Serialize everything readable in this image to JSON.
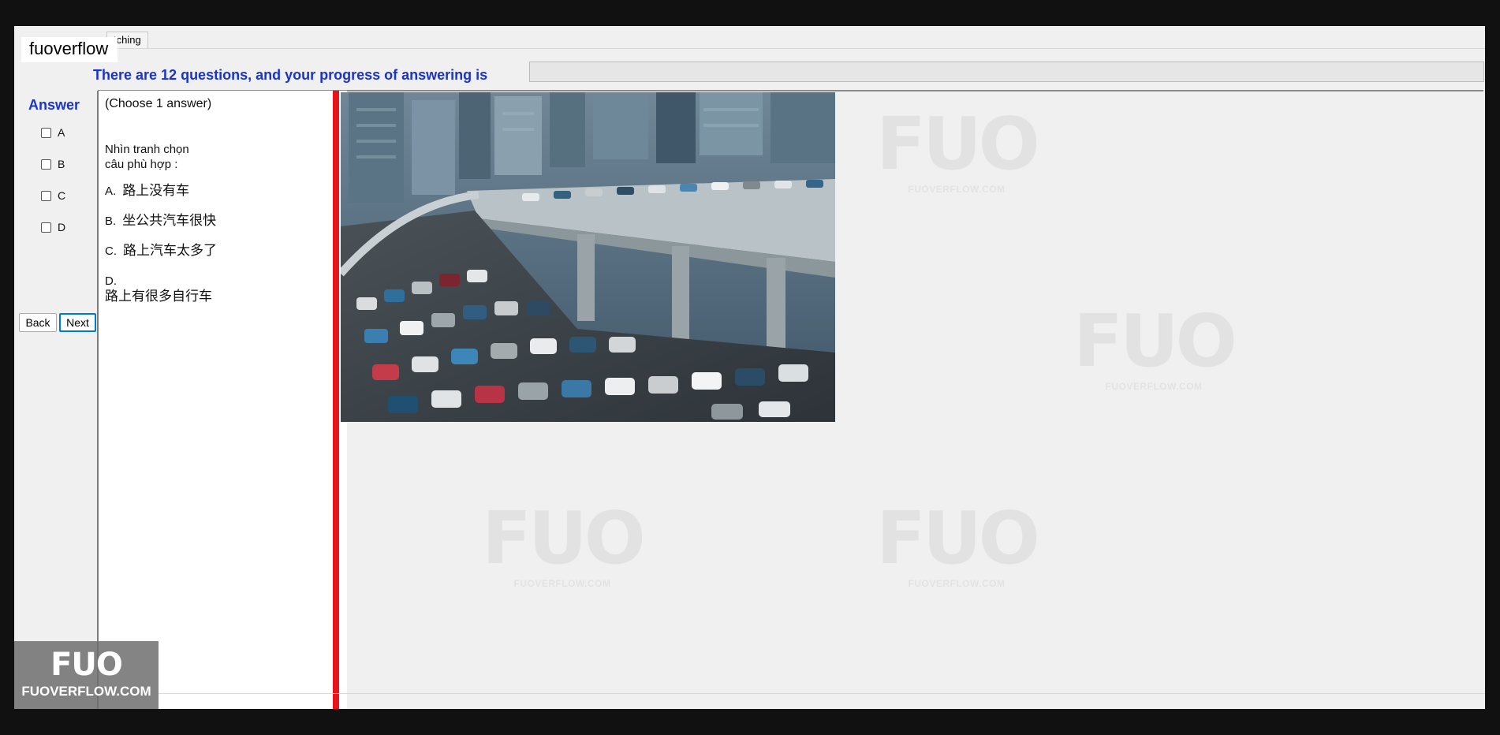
{
  "brand": {
    "label": "fuoverflow"
  },
  "tab": {
    "label": "tching"
  },
  "progress": {
    "text": "There are 12 questions, and your progress of answering is",
    "total_questions": 12,
    "answered_fraction": 0.0
  },
  "answer_panel": {
    "title": "Answer",
    "options": [
      "A",
      "B",
      "C",
      "D"
    ]
  },
  "navigation": {
    "back_label": "Back",
    "next_label": "Next"
  },
  "question": {
    "instruction": "(Choose 1 answer)",
    "prompt_line1": "Nhìn tranh chọn",
    "prompt_line2": "câu phù hợp :",
    "options": [
      {
        "key": "A.",
        "text": "路上没有车"
      },
      {
        "key": "B.",
        "text": "坐公共汽车很快"
      },
      {
        "key": "C.",
        "text": "路上汽车太多了"
      },
      {
        "key": "D.",
        "text": "路上有很多自行车"
      }
    ]
  },
  "watermark": {
    "mark": "FUO",
    "site": "FUOVERFLOW.COM"
  },
  "logo": {
    "mark": "FUO",
    "site": "FUOVERFLOW.COM"
  },
  "colors": {
    "accent": "#1a33cc",
    "red_bar": "#e8141b",
    "focus": "#0078d7"
  }
}
